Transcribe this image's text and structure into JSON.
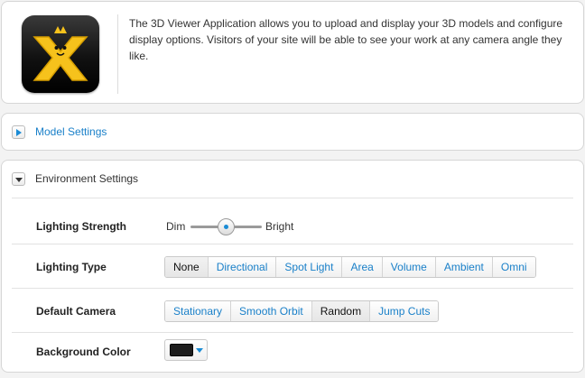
{
  "intro": {
    "logo_icon": "wix-x-logo-icon",
    "description": "The 3D Viewer Application allows you to upload and display your 3D models and configure display options. Visitors of your site will be able to see your work at any camera angle they like."
  },
  "model_settings": {
    "title": "Model Settings",
    "expanded": false,
    "icon": "triangle-right-icon"
  },
  "environment_settings": {
    "title": "Environment Settings",
    "expanded": true,
    "icon": "triangle-down-icon",
    "lighting_strength": {
      "label": "Lighting Strength",
      "min_label": "Dim",
      "max_label": "Bright",
      "value": 0.5
    },
    "lighting_type": {
      "label": "Lighting Type",
      "options": [
        "None",
        "Directional",
        "Spot Light",
        "Area",
        "Volume",
        "Ambient",
        "Omni"
      ],
      "selected": "None"
    },
    "default_camera": {
      "label": "Default Camera",
      "options": [
        "Stationary",
        "Smooth Orbit",
        "Random",
        "Jump Cuts"
      ],
      "selected": "Random"
    },
    "background_color": {
      "label": "Background Color",
      "value": "#1d1d1d"
    }
  },
  "colors": {
    "accent": "#1a80c9",
    "panel_border": "#d6d6d6",
    "background": "#f3f3f3"
  }
}
